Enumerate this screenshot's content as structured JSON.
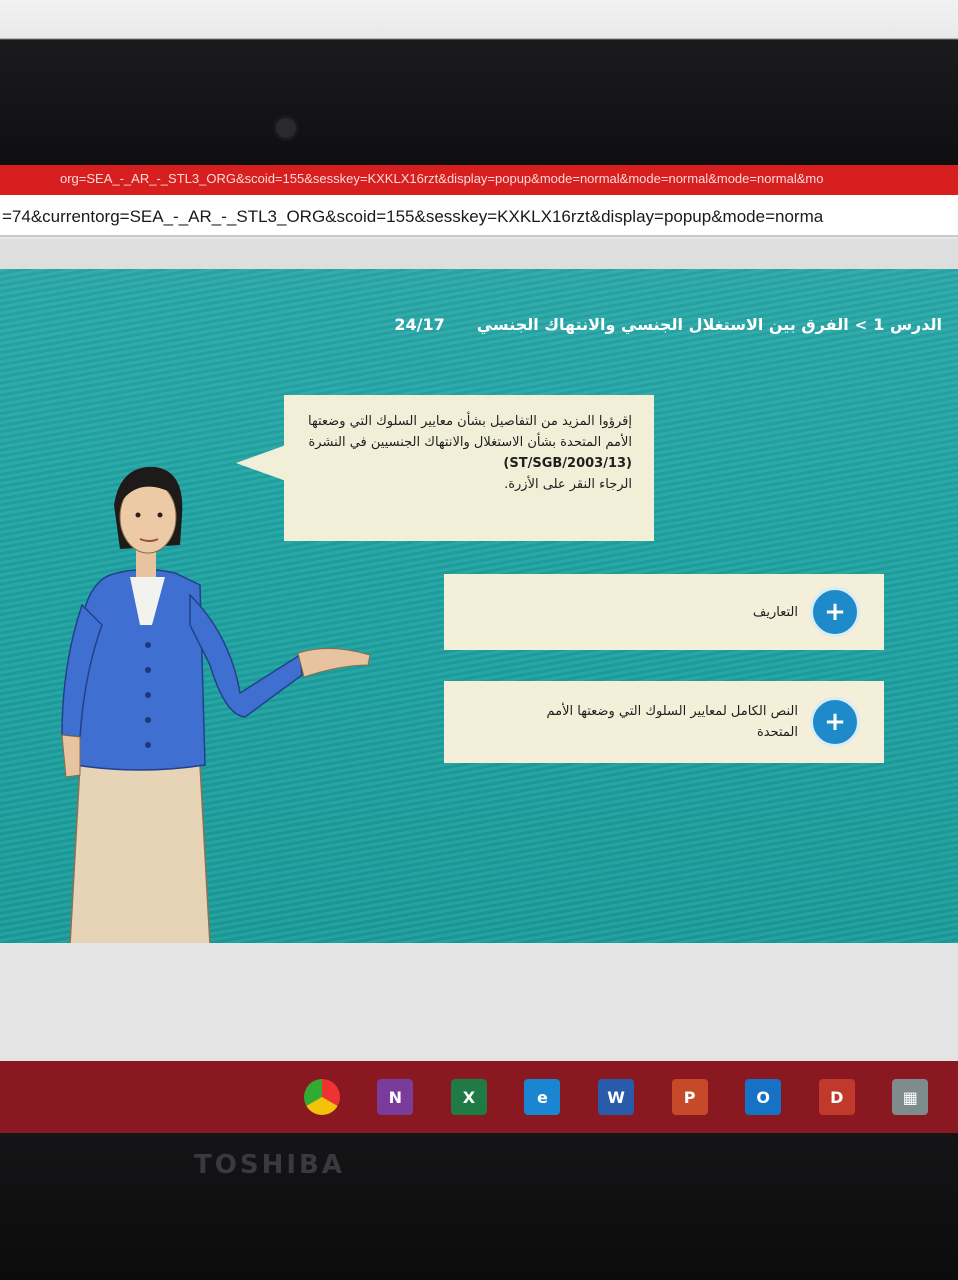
{
  "browser": {
    "title_url": "org=SEA_-_AR_-_STL3_ORG&scoid=155&sesskey=KXKLX16rzt&display=popup&mode=normal&mode=normal&mode=normal&mo",
    "address_url": "=74&currentorg=SEA_-_AR_-_STL3_ORG&scoid=155&sesskey=KXKLX16rzt&display=popup&mode=norma"
  },
  "lesson": {
    "lesson_label": "الدرس 1",
    "separator": ">",
    "lesson_title": "الفرق بين الاستغلال الجنسي والانتهاك الجنسي",
    "progress": "24/17"
  },
  "speech_bubble": {
    "text_main": "إقرؤوا المزيد من التفاصيل بشأن معايير السلوك التي وضعتها الأمم المتحدة بشأن الاستغلال والانتهاك الجنسيين في النشرة",
    "code": "(ST/SGB/2003/13)",
    "text_instruction": "الرجاء النقر على الأزرة."
  },
  "accordion": [
    {
      "label": "التعاريف",
      "button": "+"
    },
    {
      "label": "النص الكامل لمعايير السلوك التي وضعتها الأمم المتحدة",
      "button": "+"
    }
  ],
  "taskbar": [
    {
      "icon": "chrome-icon",
      "glyph": "",
      "color": "#e8a33a"
    },
    {
      "icon": "onenote-icon",
      "glyph": "N",
      "color": "#7a3c9a"
    },
    {
      "icon": "excel-icon",
      "glyph": "X",
      "color": "#1f7a45"
    },
    {
      "icon": "edge-icon",
      "glyph": "e",
      "color": "#1a86d1"
    },
    {
      "icon": "word-icon",
      "glyph": "W",
      "color": "#2a5bab"
    },
    {
      "icon": "powerpoint-icon",
      "glyph": "P",
      "color": "#c6492a"
    },
    {
      "icon": "outlook-icon",
      "glyph": "O",
      "color": "#1672c4"
    },
    {
      "icon": "acrobat-icon",
      "glyph": "D",
      "color": "#c0392b"
    },
    {
      "icon": "photos-icon",
      "glyph": "▦",
      "color": "#7f8c8d"
    }
  ],
  "device": {
    "brand": "TOSHIBA"
  }
}
